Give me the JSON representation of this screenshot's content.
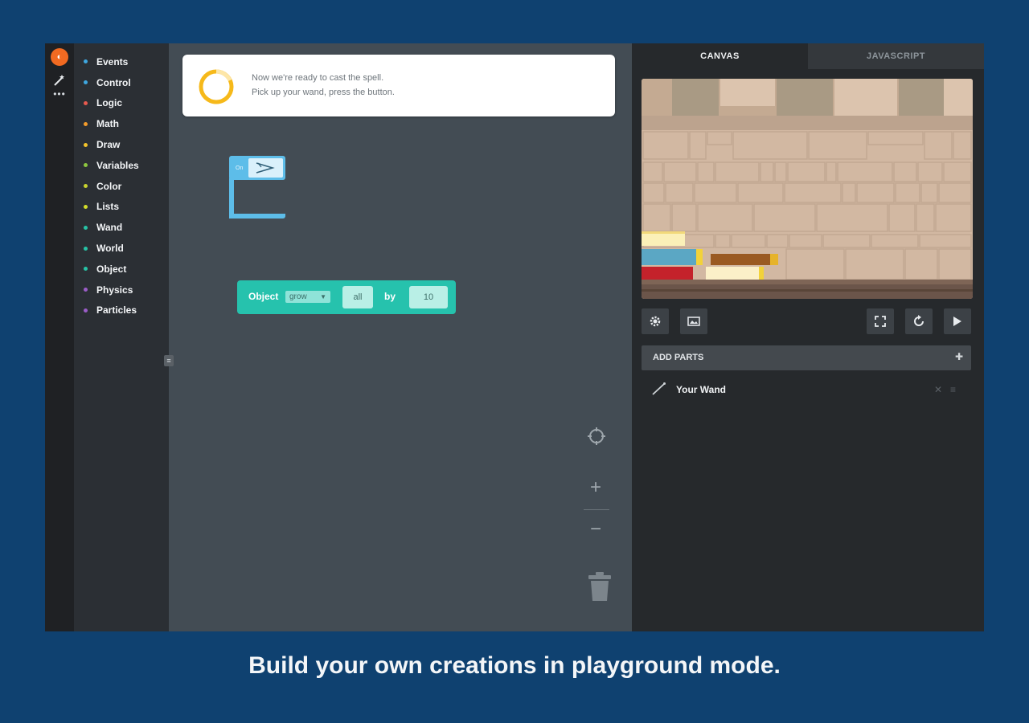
{
  "categories": [
    {
      "label": "Events",
      "color": "#3ea7e0"
    },
    {
      "label": "Control",
      "color": "#3ea7e0"
    },
    {
      "label": "Logic",
      "color": "#e85a4f"
    },
    {
      "label": "Math",
      "color": "#f39c2b"
    },
    {
      "label": "Draw",
      "color": "#f3c42b"
    },
    {
      "label": "Variables",
      "color": "#8dc63f"
    },
    {
      "label": "Color",
      "color": "#c8d32e"
    },
    {
      "label": "Lists",
      "color": "#d3dd2a"
    },
    {
      "label": "Wand",
      "color": "#27c3a6"
    },
    {
      "label": "World",
      "color": "#27c3a6"
    },
    {
      "label": "Object",
      "color": "#27c3a6"
    },
    {
      "label": "Physics",
      "color": "#9b5dc8"
    },
    {
      "label": "Particles",
      "color": "#9b5dc8"
    }
  ],
  "hint": {
    "line1": "Now we're ready to cast the spell.",
    "line2": "Pick up your wand, press the button."
  },
  "on_block": {
    "label": "On"
  },
  "object_block": {
    "label": "Object",
    "dropdown": "grow",
    "target": "all",
    "by": "by",
    "amount": "10"
  },
  "tabs": {
    "canvas": "CANVAS",
    "javascript": "JAVASCRIPT"
  },
  "add_parts": {
    "label": "ADD PARTS"
  },
  "parts": [
    {
      "label": "Your Wand",
      "icon": "wand-icon"
    }
  ],
  "caption": "Build your own creations in playground mode."
}
